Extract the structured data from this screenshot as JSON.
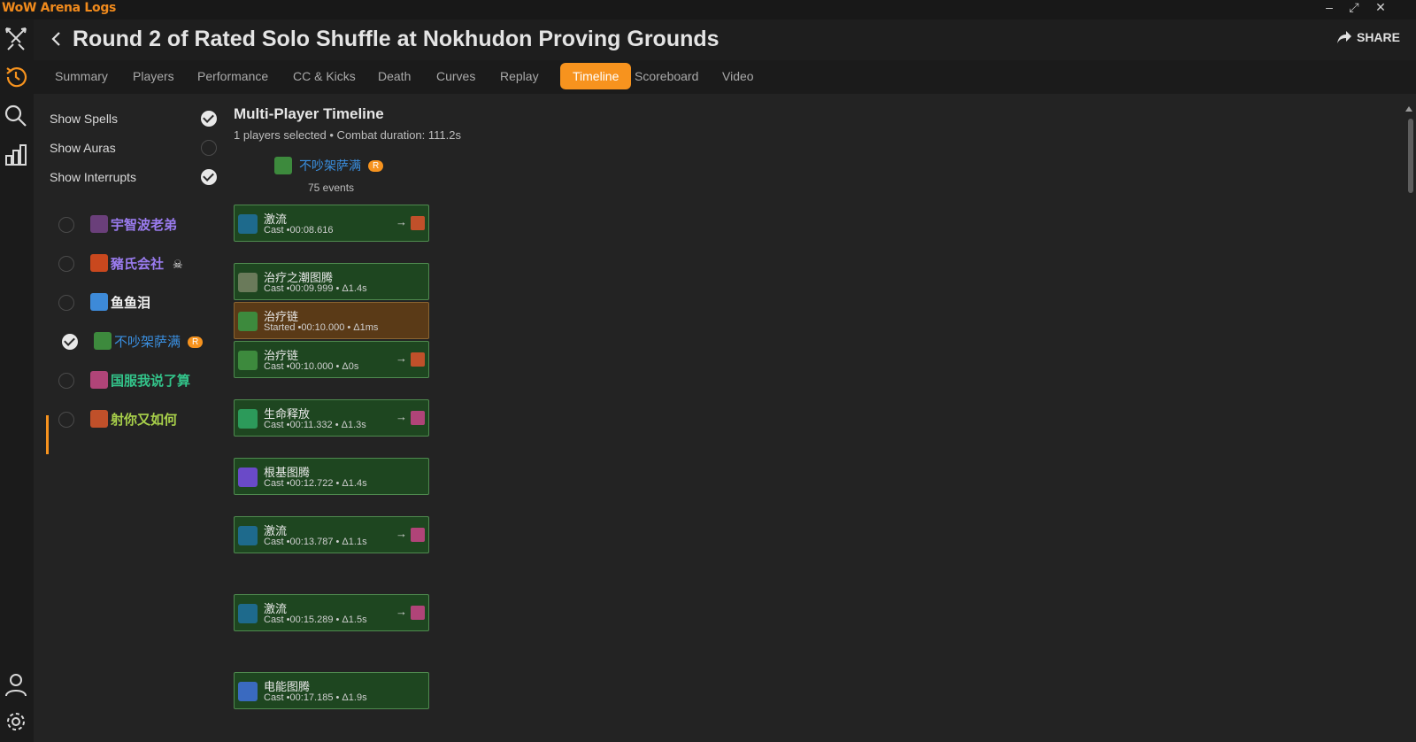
{
  "app": {
    "title": "WoW Arena Logs"
  },
  "window_controls": {
    "minimize": "–",
    "maximize": "⤢",
    "close": "✕"
  },
  "header": {
    "title": "Round 2 of Rated Solo Shuffle at Nokhudon Proving Grounds",
    "share_label": "SHARE"
  },
  "tabs": [
    {
      "label": "Summary"
    },
    {
      "label": "Players"
    },
    {
      "label": "Performance"
    },
    {
      "label": "CC & Kicks"
    },
    {
      "label": "Death"
    },
    {
      "label": "Curves"
    },
    {
      "label": "Replay"
    },
    {
      "label": "Timeline",
      "active": true
    },
    {
      "label": "Scoreboard"
    },
    {
      "label": "Video"
    }
  ],
  "options": [
    {
      "label": "Show Spells",
      "checked": true
    },
    {
      "label": "Show Auras",
      "checked": false
    },
    {
      "label": "Show Interrupts",
      "checked": true
    }
  ],
  "players": [
    {
      "name": "宇智波老弟",
      "color": "#9b7cf0",
      "icon_color": "#6a3f7a",
      "checked": false
    },
    {
      "name": "豬氏会社",
      "color": "#9b7cf0",
      "icon_color": "#c9481e",
      "checked": false,
      "dead": true,
      "dead_icon": "☠"
    },
    {
      "name": "鱼鱼泪",
      "color": "#f2f2f2",
      "icon_color": "#3d8ad8",
      "checked": false
    },
    {
      "name": "不吵架萨满",
      "color": "#3a8fe0",
      "icon_color": "#3d8a3d",
      "checked": true,
      "badge": "R"
    },
    {
      "name": "国服我说了算",
      "color": "#33c48a",
      "icon_color": "#b04478",
      "checked": false
    },
    {
      "name": "射你又如何",
      "color": "#a8d04a",
      "icon_color": "#c0502a",
      "checked": false
    }
  ],
  "timeline": {
    "title": "Multi-Player Timeline",
    "subtitle": "1 players selected • Combat duration: 111.2s",
    "column": {
      "player": "不吵架萨满",
      "badge": "R",
      "events_label": "75 events"
    },
    "arrow": "→",
    "events": [
      {
        "name": "激流",
        "detail": "Cast •00:08.616",
        "kind": "cast",
        "icon_color": "#1e6a8c",
        "target_color": "#c0502a"
      },
      {
        "name": "治疗之潮图腾",
        "detail": "Cast •00:09.999 • Δ1.4s",
        "kind": "cast",
        "icon_color": "#6a7a5a"
      },
      {
        "name": "治疗链",
        "detail": "Started •00:10.000 • Δ1ms",
        "kind": "started",
        "icon_color": "#3d8a3d"
      },
      {
        "name": "治疗链",
        "detail": "Cast •00:10.000 • Δ0s",
        "kind": "cast",
        "icon_color": "#3d8a3d",
        "target_color": "#c0502a"
      },
      {
        "name": "生命释放",
        "detail": "Cast •00:11.332 • Δ1.3s",
        "kind": "cast",
        "icon_color": "#2c9a5a",
        "target_color": "#b04478"
      },
      {
        "name": "根基图腾",
        "detail": "Cast •00:12.722 • Δ1.4s",
        "kind": "cast",
        "icon_color": "#6a4ac8"
      },
      {
        "name": "激流",
        "detail": "Cast •00:13.787 • Δ1.1s",
        "kind": "cast",
        "icon_color": "#1e6a8c",
        "target_color": "#b04478"
      },
      {
        "name": "激流",
        "detail": "Cast •00:15.289 • Δ1.5s",
        "kind": "cast",
        "icon_color": "#1e6a8c",
        "target_color": "#b04478"
      },
      {
        "name": "电能图腾",
        "detail": "Cast •00:17.185 • Δ1.9s",
        "kind": "cast",
        "icon_color": "#3a6ac0"
      }
    ]
  },
  "colors": {
    "accent": "#f7931e",
    "event_bg": "#1e4620",
    "event_started_bg": "#5a3a17"
  }
}
